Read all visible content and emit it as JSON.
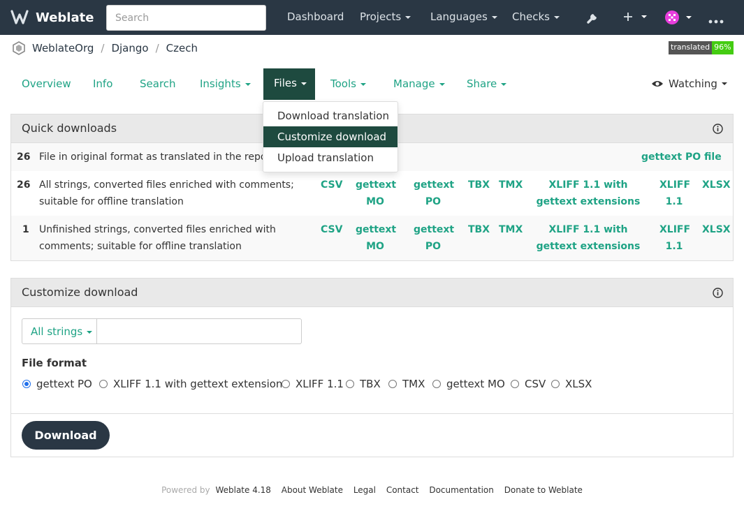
{
  "navbar": {
    "brand": "Weblate",
    "search_placeholder": "Search",
    "items": [
      {
        "label": "Dashboard"
      },
      {
        "label": "Projects"
      },
      {
        "label": "Languages"
      },
      {
        "label": "Checks"
      }
    ],
    "icons": [
      "wrench-icon",
      "plus-icon",
      "avatar",
      "more-icon"
    ]
  },
  "breadcrumb": {
    "items": [
      "WeblateOrg",
      "Django",
      "Czech"
    ],
    "badge_label": "translated",
    "badge_value": "96%"
  },
  "tabs": {
    "items": [
      "Overview",
      "Info",
      "Search",
      "Insights",
      "Files",
      "Tools",
      "Manage",
      "Share"
    ],
    "active": "Files",
    "watching": "Watching"
  },
  "files_menu": {
    "items": [
      "Download translation",
      "Customize download",
      "Upload translation"
    ],
    "highlighted": "Customize download"
  },
  "quick_downloads": {
    "title": "Quick downloads",
    "rows": [
      {
        "count": "26",
        "description": "File in original format as translated in the repo",
        "formats": [
          "gettext PO file"
        ]
      },
      {
        "count": "26",
        "description": "All strings, converted files enriched with comments; suitable for offline translation",
        "formats": [
          "CSV",
          "gettext MO",
          "gettext PO",
          "TBX",
          "TMX",
          "XLIFF 1.1 with gettext extensions",
          "XLIFF 1.1",
          "XLSX"
        ]
      },
      {
        "count": "1",
        "description": "Unfinished strings, converted files enriched with comments; suitable for offline translation",
        "formats": [
          "CSV",
          "gettext MO",
          "gettext PO",
          "TBX",
          "TMX",
          "XLIFF 1.1 with gettext extensions",
          "XLIFF 1.1",
          "XLSX"
        ]
      }
    ]
  },
  "customize_download": {
    "title": "Customize download",
    "filter_selected": "All strings",
    "filter_value": "",
    "file_format_label": "File format",
    "formats": [
      "gettext PO",
      "XLIFF 1.1 with gettext extensions",
      "XLIFF 1.1",
      "TBX",
      "TMX",
      "gettext MO",
      "CSV",
      "XLSX"
    ],
    "selected_format": "gettext PO",
    "download_label": "Download"
  },
  "footer": {
    "powered_by": "Powered by",
    "links": [
      "Weblate 4.18",
      "About Weblate",
      "Legal",
      "Contact",
      "Documentation",
      "Donate to Weblate"
    ]
  },
  "colors": {
    "navbar": "#2a3744",
    "accent": "#1fa385",
    "active_tab": "#1e4a3f",
    "badge_green": "#44cc11"
  }
}
